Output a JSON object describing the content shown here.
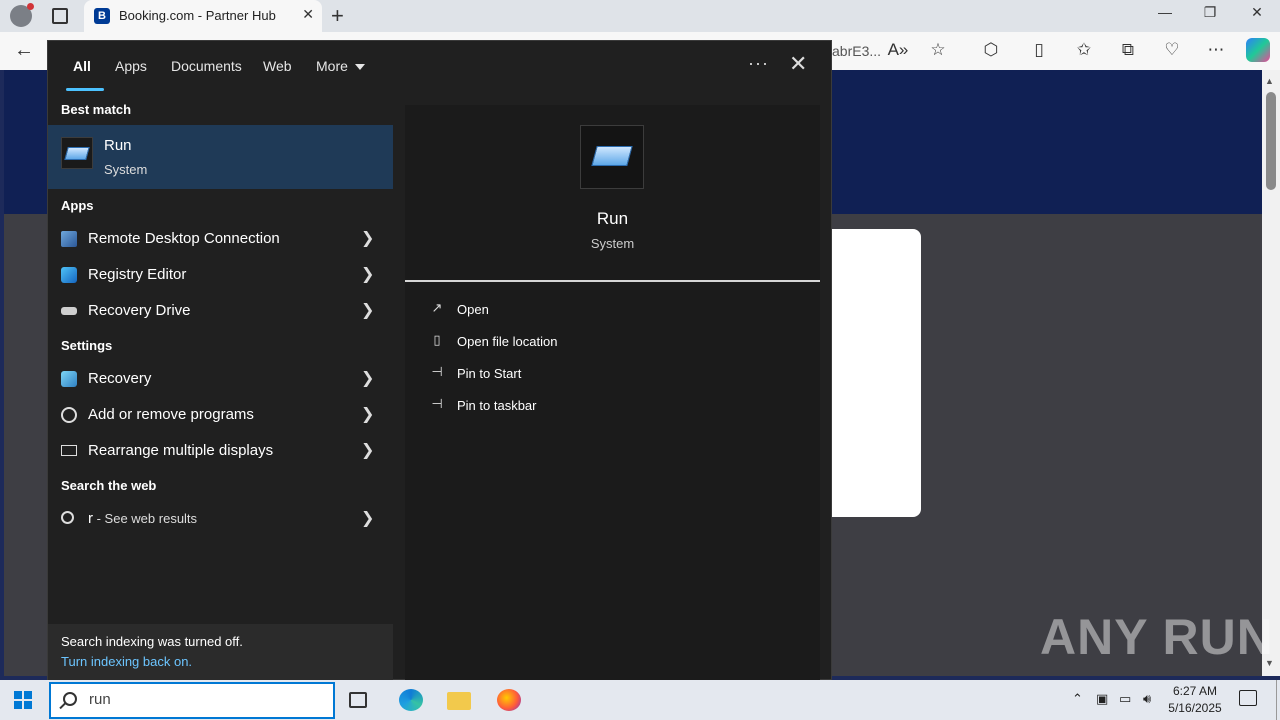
{
  "browser": {
    "tab_title": "Booking.com - Partner Hub",
    "tab_favicon": "B",
    "address_tail": "abrE3...",
    "accent": "#003b95"
  },
  "search_panel": {
    "filters": [
      "All",
      "Apps",
      "Documents",
      "Web",
      "More"
    ],
    "active_filter": "All",
    "best_match_heading": "Best match",
    "best_match": {
      "title": "Run",
      "subtitle": "System",
      "icon": "run-icon"
    },
    "apps_heading": "Apps",
    "apps": [
      {
        "label": "Remote Desktop Connection",
        "icon": "remote-desktop-icon"
      },
      {
        "label": "Registry Editor",
        "icon": "registry-editor-icon"
      },
      {
        "label": "Recovery Drive",
        "icon": "recovery-drive-icon"
      }
    ],
    "settings_heading": "Settings",
    "settings": [
      {
        "label": "Recovery",
        "icon": "recovery-icon"
      },
      {
        "label": "Add or remove programs",
        "icon": "gear-icon"
      },
      {
        "label": "Rearrange multiple displays",
        "icon": "monitor-icon"
      }
    ],
    "web_heading": "Search the web",
    "web_query": "r",
    "web_suffix": " - See web results",
    "indexing_notice": "Search indexing was turned off.",
    "indexing_link": "Turn indexing back on.",
    "preview": {
      "title": "Run",
      "subtitle": "System",
      "actions": [
        "Open",
        "Open file location",
        "Pin to Start",
        "Pin to taskbar"
      ]
    },
    "highlight_color": "#1f3a57",
    "link_color": "#6cc5ff"
  },
  "taskbar": {
    "search_value": "run",
    "time": "6:27 AM",
    "date": "5/16/2025"
  },
  "watermark": "ANY RUN"
}
